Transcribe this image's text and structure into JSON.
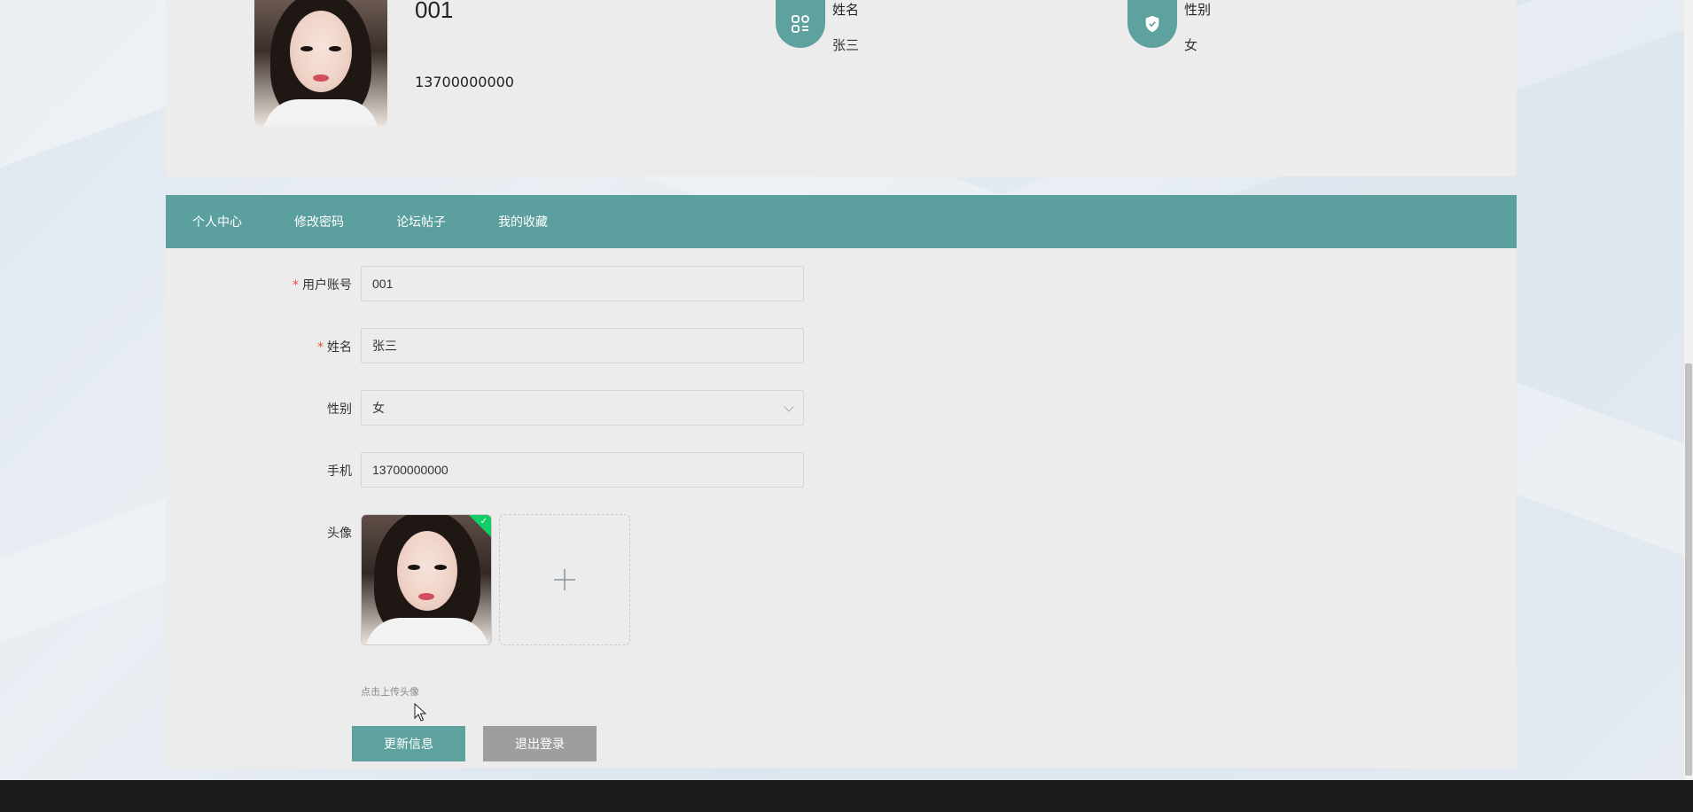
{
  "profile": {
    "account": "001",
    "phone": "13700000000",
    "name_label": "姓名",
    "name_value": "张三",
    "gender_label": "性别",
    "gender_value": "女"
  },
  "nav": {
    "items": [
      {
        "label": "个人中心"
      },
      {
        "label": "修改密码"
      },
      {
        "label": "论坛帖子"
      },
      {
        "label": "我的收藏"
      }
    ]
  },
  "form": {
    "account_label": "用户账号",
    "account_value": "001",
    "name_label": "姓名",
    "name_value": "张三",
    "gender_label": "性别",
    "gender_value": "女",
    "phone_label": "手机",
    "phone_value": "13700000000",
    "avatar_label": "头像",
    "upload_tip": "点击上传头像",
    "required_mark": "*"
  },
  "buttons": {
    "update": "更新信息",
    "logout": "退出登录"
  },
  "colors": {
    "accent": "#5ea29f",
    "nav_bg": "#5b9f9e",
    "logout_bg": "#9e9e9e",
    "success": "#13ce66"
  }
}
